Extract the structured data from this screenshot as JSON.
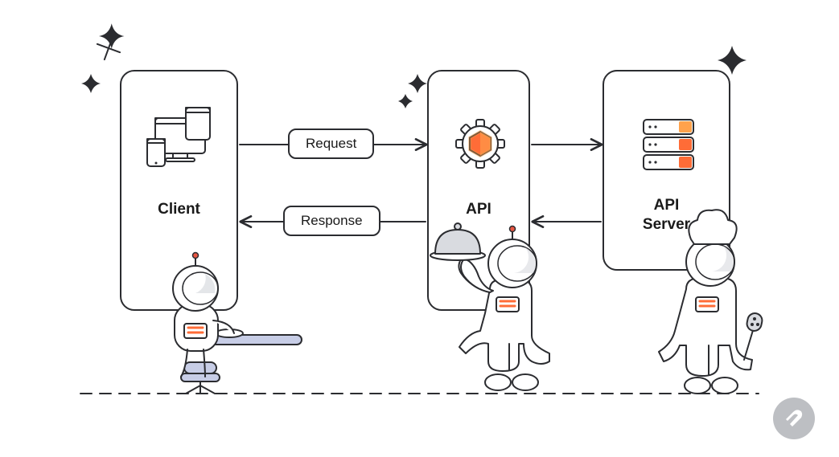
{
  "diagram": {
    "nodes": {
      "client": {
        "label": "Client",
        "icon": "devices-icon"
      },
      "api": {
        "label": "API",
        "icon": "hex-gear-icon"
      },
      "api_server": {
        "label": "API\nServer",
        "icon": "server-stack-icon"
      }
    },
    "edges": {
      "request": {
        "label": "Request",
        "from": "client",
        "to": "api",
        "direction": "right"
      },
      "response": {
        "label": "Response",
        "from": "api",
        "to": "client",
        "direction": "left"
      },
      "api_to_server": {
        "from": "api",
        "to": "api_server",
        "direction": "right"
      },
      "server_to_api": {
        "from": "api_server",
        "to": "api",
        "direction": "left"
      }
    },
    "characters": {
      "customer": "astronaut-seated",
      "waiter": "astronaut-waiter-with-cloche",
      "chef": "astronaut-chef"
    },
    "accent_color": "#ff6c37",
    "accent_light": "#ffa24c",
    "stroke_color": "#2b2c30"
  },
  "brand": {
    "logo": "postman-icon"
  }
}
